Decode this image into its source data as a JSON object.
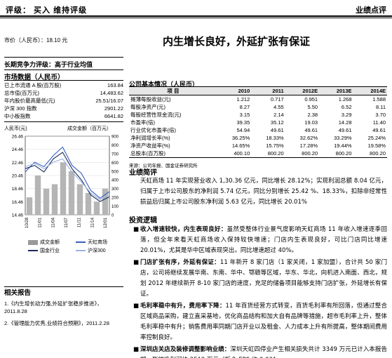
{
  "header": {
    "rating_text": "评级：  买入       维持评级",
    "report_type": "业绩点评"
  },
  "price_label": "市价（人民币）：18.10 元",
  "headline": "内生增长良好，外延扩张有保证",
  "long_term_rating": "长期竞争力评级：高于行业均值",
  "market_data": {
    "title": "市场数据（人民币）",
    "rows": [
      {
        "label": "已上市流通 A 股(百万股)",
        "value": "163.84"
      },
      {
        "label": "总市值(百万元)",
        "value": "14,483.62"
      },
      {
        "label": "年内股价最高最低(元)",
        "value": "25.51/16.07"
      },
      {
        "label": "沪深 300 指数",
        "value": "2901.22"
      },
      {
        "label": "中小板指数",
        "value": "6641.82"
      }
    ]
  },
  "stock_chart": {
    "left_axis_title": "人民币(元)",
    "right_axis_title": "成交金额（百万元）",
    "y_ticks": [
      "26.46",
      "24.46",
      "22.46",
      "20.46",
      "18.46",
      "16.46",
      "14.46"
    ],
    "right_ticks": [
      "900",
      "800",
      "700",
      "600",
      "500",
      "400",
      "300",
      "200",
      "100",
      "0"
    ],
    "x_ticks": [
      "10/28",
      "11/01",
      "11/04",
      "11/07",
      "11/11",
      "11/14",
      "12/01"
    ],
    "legend": [
      {
        "label": "成交金额",
        "color": "#9a9a9a"
      },
      {
        "label": "天虹商场",
        "color": "#3a5fc0"
      },
      {
        "label": "国金行业",
        "color": "#1a2a5a"
      },
      {
        "label": "沪深300",
        "color": "#9bb3e0"
      }
    ]
  },
  "chart_data": {
    "type": "line",
    "title": "",
    "x": [
      "10/28",
      "11/01",
      "11/04",
      "11/07",
      "11/11",
      "11/14",
      "12/01"
    ],
    "series": [
      {
        "name": "天虹商场",
        "values": [
          21.0,
          22.5,
          21.8,
          23.5,
          24.8,
          22.0,
          20.8,
          18.2,
          17.0,
          18.0
        ]
      },
      {
        "name": "国金行业",
        "values": [
          21.5,
          22.0,
          21.0,
          23.0,
          24.0,
          21.5,
          19.8,
          17.5,
          16.5,
          17.2
        ]
      },
      {
        "name": "沪深300",
        "values": [
          21.8,
          22.3,
          21.5,
          22.5,
          23.0,
          21.0,
          19.5,
          17.8,
          16.8,
          17.5
        ]
      },
      {
        "name": "成交金额",
        "values": [
          200,
          450,
          300,
          350,
          600,
          500,
          350,
          250,
          150,
          300
        ]
      }
    ],
    "ylabel": "人民币(元)",
    "y2label": "成交金额（百万元）",
    "ylim": [
      14.46,
      26.46
    ],
    "y2lim": [
      0,
      900
    ]
  },
  "related": {
    "title": "相关报告",
    "items": [
      "1.《内生增长动力强,外延扩张稳步推进》，2011.8.28",
      "2.《管理能力优秀,业绩符合预期》，2011.2.28"
    ]
  },
  "fin_table": {
    "title": "公司基本情况（人民币）",
    "columns": [
      "项  目",
      "2010",
      "2011",
      "2012E",
      "2013E",
      "2014E"
    ],
    "rows": [
      [
        "摊薄每股收益(元)",
        "1.212",
        "0.717",
        "0.951",
        "1.268",
        "1.588"
      ],
      [
        "每股净资产(元)",
        "8.27",
        "4.55",
        "5.50",
        "6.52",
        "8.11"
      ],
      [
        "每股经营性现金流(元)",
        "3.15",
        "2.14",
        "2.38",
        "3.29",
        "3.70"
      ],
      [
        "市盈率(倍)",
        "39.35",
        "35.12",
        "19.03",
        "14.28",
        "11.40"
      ],
      [
        "行业优化市盈率(倍)",
        "54.94",
        "49.61",
        "49.61",
        "49.61",
        "49.61"
      ],
      [
        "净利润增长率(%)",
        "36.25%",
        "18.33%",
        "32.62%",
        "33.29%",
        "25.24%"
      ],
      [
        "净资产收益率(%)",
        "14.65%",
        "15.75%",
        "17.28%",
        "19.44%",
        "19.58%"
      ],
      [
        "总股本(百万股)",
        "400.10",
        "800.20",
        "800.20",
        "800.20",
        "800.20"
      ]
    ],
    "source": "来源：公司年报、国金证券研究所"
  },
  "summary": {
    "title": "业绩简评",
    "text": "天虹商场 11 年实现营业收入 1,30.36 亿元，同比增长 28.12%；实现利润总额 8.04 亿元，归属于上市公司股东的净利润 5.74 亿元，同比分别增长 25.42 %、18.33%，扣除非经常性损益后归属上市公司股东净利润 5.63 亿元，同比增长 20.01%"
  },
  "investment": {
    "title": "投资逻辑",
    "bullets": [
      {
        "bold": "收入增速较快，内生表现良好：",
        "text": "虽然受整体行业景气度影响天虹商场 11 年收入增速逐季回落，但全年来看天虹商场收入保持较快增速；门店内生表现良好，可比门店同比增速 20.01%，尤其是华中区域表现突出，同比增速超过 40%。"
      },
      {
        "bold": "门店扩张有序，外延有保证：",
        "text": "11 年新开 8 家门店（1 家关闭，1 家加盟），合计共 50 家门店，公司将继续发展华南、东南、华中、鄂赣等区域，华东、华北，向机进入南面、西北，规划 2012 年继续新开 8-10 家门店的速度，充足的储备项目能够支持门店扩张，外延增长有保证。"
      },
      {
        "bold": "毛利率稳中有升，费用率下降：",
        "text": "11 年百货经营方式转变，百货毛利率有所回落，但通过整合区域商品采购，建立直采基地，优化商品结构和加大自有品牌等措施，超市毛利率上升，整体毛利率稳中有升；销售费用率同期门店开业以及租金、人力成本上升有所提高，整体期间费用率控制良好。"
      },
      {
        "bold": "深圳店关店及装修调整影响业绩：",
        "text": "深圳天虹四停业产生相关损失共计 3349 万元已计入本报告期，影响净利润约 2512 万元（折合 EPS 约 0.031"
      }
    ]
  }
}
